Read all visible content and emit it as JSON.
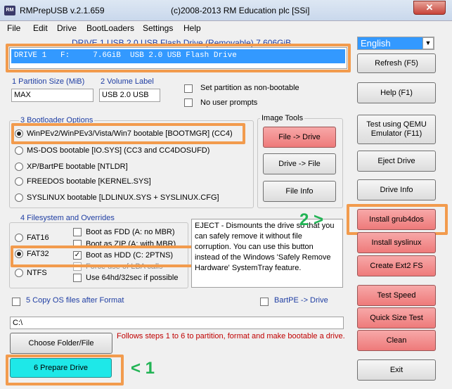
{
  "window": {
    "title": "RMPrepUSB v.2.1.659",
    "title_center": "(c)2008-2013 RM Education plc [SSi]",
    "app_icon_text": "RM",
    "close_glyph": "✕"
  },
  "menu": [
    "File",
    "Edit",
    "Drive",
    "BootLoaders",
    "Settings",
    "Help"
  ],
  "drive_header": "DRIVE 1 USB 2.0 USB Flash Drive  (Removable) 7.606GiB",
  "drive_list_item": "DRIVE 1   F:     7.6GiB  USB 2.0 USB Flash Drive",
  "language": {
    "selected": "English"
  },
  "partition": {
    "size_label": "1 Partition Size (MiB)",
    "size_value": "MAX",
    "volume_label": "2 Volume Label",
    "volume_value": "USB 2.0 USB",
    "non_bootable_label": "Set partition as non-bootable",
    "no_user_prompts_label": "No user prompts"
  },
  "bootloader": {
    "title": "3 Bootloader Options",
    "options": [
      {
        "label": "WinPEv2/WinPEv3/Vista/Win7 bootable [BOOTMGR] (CC4)",
        "selected": true
      },
      {
        "label": "MS-DOS bootable [IO.SYS]    (CC3 and CC4DOSUFD)",
        "selected": false
      },
      {
        "label": "XP/BartPE bootable [NTLDR]",
        "selected": false
      },
      {
        "label": "FREEDOS bootable [KERNEL.SYS]",
        "selected": false
      },
      {
        "label": "SYSLINUX bootable [LDLINUX.SYS + SYSLINUX.CFG]",
        "selected": false
      }
    ]
  },
  "image_tools": {
    "title": "Image Tools",
    "file_to_drive": "File -> Drive",
    "drive_to_file": "Drive -> File",
    "file_info": "File Info"
  },
  "filesystem": {
    "title": "4 Filesystem and Overrides",
    "fs_options": [
      {
        "label": "FAT16",
        "selected": false
      },
      {
        "label": "FAT32",
        "selected": true
      },
      {
        "label": "NTFS",
        "selected": false
      }
    ],
    "overrides": [
      {
        "label": "Boot as FDD (A: no MBR)",
        "checked": false
      },
      {
        "label": "Boot as ZIP (A: with MBR)",
        "checked": false
      },
      {
        "label": "Boot as HDD (C: 2PTNS)",
        "checked": true
      },
      {
        "label": "Force use of LBA calls",
        "checked": false
      },
      {
        "label": "Use 64hd/32sec if possible",
        "checked": false
      }
    ]
  },
  "info_text": "EJECT - Dismounts the drive so that you can safely remove it without file corruption. You can use this button instead of the Windows 'Safely Remove Hardware' SystemTray feature.",
  "copy_os_label": "5 Copy OS files after Format",
  "bartpe_label": "BartPE -> Drive",
  "path_value": "C:\\",
  "choose_folder": "Choose Folder/File",
  "follow_steps": "Follows steps 1 to 6 to partition, format and make bootable a drive.",
  "prepare_drive": "6 Prepare Drive",
  "right_buttons": {
    "refresh": "Refresh (F5)",
    "help": "Help (F1)",
    "test_qemu": "Test using QEMU Emulator (F11)",
    "eject": "Eject Drive",
    "drive_info": "Drive Info",
    "install_grub4dos": "Install grub4dos",
    "install_syslinux": "Install syslinux",
    "create_ext2": "Create Ext2 FS",
    "test_speed": "Test Speed",
    "quick_size_test": "Quick Size Test",
    "clean": "Clean",
    "exit": "Exit"
  },
  "annotations": {
    "step1": "< 1",
    "step2": "2 >"
  },
  "colors": {
    "highlight_orange": "#f29b4d",
    "annotation_green": "#22b455",
    "selected_blue": "#3399ff",
    "red_button": "#ee7a7a",
    "prepare_cyan": "#1ee8e8"
  }
}
